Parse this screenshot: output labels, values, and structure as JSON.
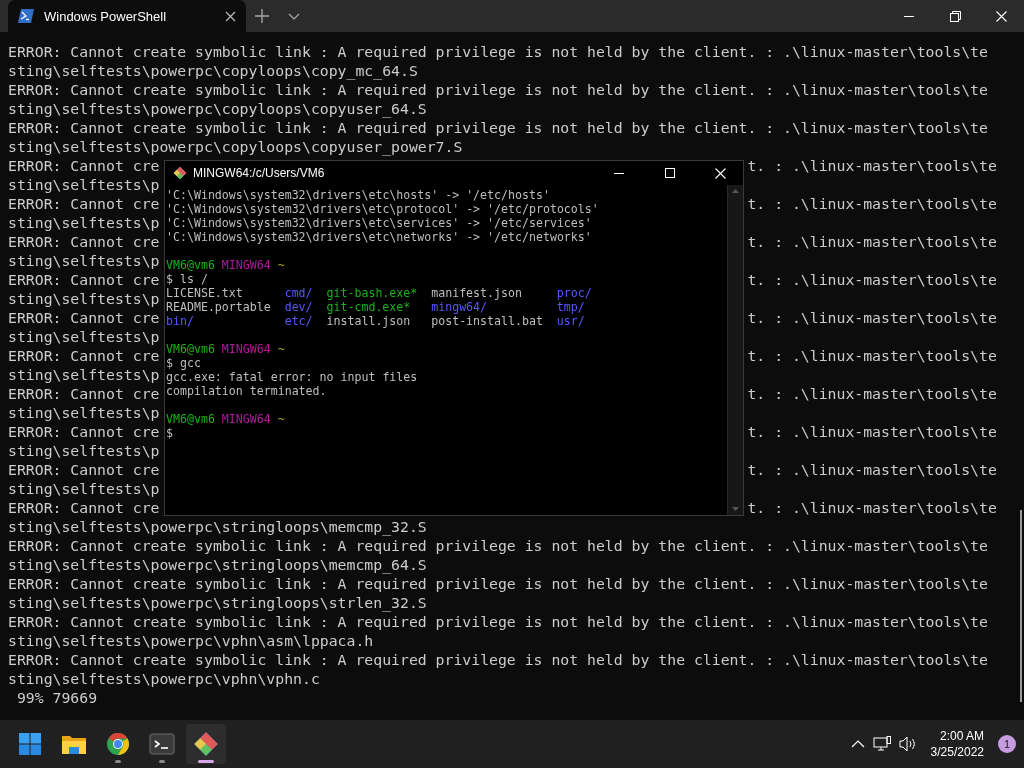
{
  "window": {
    "tab": {
      "title": "Windows PowerShell",
      "selected": true
    }
  },
  "console": {
    "lines": [
      {
        "kind": "full",
        "text": "ERROR: Cannot create symbolic link : A required privilege is not held by the client. : .\\linux-master\\tools\\te"
      },
      {
        "kind": "full",
        "text": "sting\\selftests\\powerpc\\copyloops\\copy_mc_64.S"
      },
      {
        "kind": "full",
        "text": "ERROR: Cannot create symbolic link : A required privilege is not held by the client. : .\\linux-master\\tools\\te"
      },
      {
        "kind": "full",
        "text": "sting\\selftests\\powerpc\\copyloops\\copyuser_64.S"
      },
      {
        "kind": "full",
        "text": "ERROR: Cannot create symbolic link : A required privilege is not held by the client. : .\\linux-master\\tools\\te"
      },
      {
        "kind": "full",
        "text": "sting\\selftests\\powerpc\\copyloops\\copyuser_power7.S"
      },
      {
        "kind": "split",
        "left": "ERROR: Cannot cre",
        "right": "t. : .\\linux-master\\tools\\te"
      },
      {
        "kind": "split",
        "left": "sting\\selftests\\p"
      },
      {
        "kind": "split",
        "left": "ERROR: Cannot cre",
        "right": "t. : .\\linux-master\\tools\\te"
      },
      {
        "kind": "split",
        "left": "sting\\selftests\\p"
      },
      {
        "kind": "split",
        "left": "ERROR: Cannot cre",
        "right": "t. : .\\linux-master\\tools\\te"
      },
      {
        "kind": "split",
        "left": "sting\\selftests\\p"
      },
      {
        "kind": "split",
        "left": "ERROR: Cannot cre",
        "right": "t. : .\\linux-master\\tools\\te"
      },
      {
        "kind": "split",
        "left": "sting\\selftests\\p"
      },
      {
        "kind": "split",
        "left": "ERROR: Cannot cre",
        "right": "t. : .\\linux-master\\tools\\te"
      },
      {
        "kind": "split",
        "left": "sting\\selftests\\p"
      },
      {
        "kind": "split",
        "left": "ERROR: Cannot cre",
        "right": "t. : .\\linux-master\\tools\\te"
      },
      {
        "kind": "split",
        "left": "sting\\selftests\\p"
      },
      {
        "kind": "split",
        "left": "ERROR: Cannot cre",
        "right": "t. : .\\linux-master\\tools\\te"
      },
      {
        "kind": "split",
        "left": "sting\\selftests\\p"
      },
      {
        "kind": "split",
        "left": "ERROR: Cannot cre",
        "right": "t. : .\\linux-master\\tools\\te"
      },
      {
        "kind": "split",
        "left": "sting\\selftests\\p"
      },
      {
        "kind": "split",
        "left": "ERROR: Cannot cre",
        "right": "t. : .\\linux-master\\tools\\te"
      },
      {
        "kind": "split",
        "left": "sting\\selftests\\p"
      },
      {
        "kind": "split",
        "left": "ERROR: Cannot cre",
        "right": "t. : .\\linux-master\\tools\\te"
      },
      {
        "kind": "full",
        "text": "sting\\selftests\\powerpc\\stringloops\\memcmp_32.S"
      },
      {
        "kind": "full",
        "text": "ERROR: Cannot create symbolic link : A required privilege is not held by the client. : .\\linux-master\\tools\\te"
      },
      {
        "kind": "full",
        "text": "sting\\selftests\\powerpc\\stringloops\\memcmp_64.S"
      },
      {
        "kind": "full",
        "text": "ERROR: Cannot create symbolic link : A required privilege is not held by the client. : .\\linux-master\\tools\\te"
      },
      {
        "kind": "full",
        "text": "sting\\selftests\\powerpc\\stringloops\\strlen_32.S"
      },
      {
        "kind": "full",
        "text": "ERROR: Cannot create symbolic link : A required privilege is not held by the client. : .\\linux-master\\tools\\te"
      },
      {
        "kind": "full",
        "text": "sting\\selftests\\powerpc\\vphn\\asm\\lppaca.h"
      },
      {
        "kind": "full",
        "text": "ERROR: Cannot create symbolic link : A required privilege is not held by the client. : .\\linux-master\\tools\\te"
      },
      {
        "kind": "full",
        "text": "sting\\selftests\\powerpc\\vphn\\vphn.c"
      },
      {
        "kind": "full",
        "text": " 99% 79669"
      }
    ]
  },
  "mintty": {
    "title": "MINGW64:/c/Users/VM6",
    "content": [
      {
        "kind": "line",
        "segments": [
          {
            "kind": "plain",
            "text": "'C:\\Windows\\system32\\drivers\\etc\\hosts' -> '/etc/hosts'"
          }
        ]
      },
      {
        "kind": "line",
        "segments": [
          {
            "kind": "plain",
            "text": "'C:\\Windows\\system32\\drivers\\etc\\protocol' -> '/etc/protocols'"
          }
        ]
      },
      {
        "kind": "line",
        "segments": [
          {
            "kind": "plain",
            "text": "'C:\\Windows\\system32\\drivers\\etc\\services' -> '/etc/services'"
          }
        ]
      },
      {
        "kind": "line",
        "segments": [
          {
            "kind": "plain",
            "text": "'C:\\Windows\\system32\\drivers\\etc\\networks' -> '/etc/networks'"
          }
        ]
      },
      {
        "kind": "blank"
      },
      {
        "kind": "line",
        "segments": [
          {
            "kind": "user",
            "text": "VM6@vm6"
          },
          {
            "kind": "host",
            "text": "MINGW64"
          },
          {
            "kind": "path",
            "text": "~"
          }
        ]
      },
      {
        "kind": "line",
        "segments": [
          {
            "kind": "plain",
            "text": "$ ls /"
          }
        ]
      },
      {
        "kind": "grid",
        "entries": [
          {
            "kind": "file",
            "text": "LICENSE.txt"
          },
          {
            "kind": "dir",
            "text": "cmd/"
          },
          {
            "kind": "exec",
            "text": "git-bash.exe*"
          },
          {
            "kind": "file",
            "text": "manifest.json"
          },
          {
            "kind": "dir",
            "text": "proc/"
          },
          {
            "kind": "file",
            "text": "README.portable"
          },
          {
            "kind": "dir",
            "text": "dev/"
          },
          {
            "kind": "exec",
            "text": "git-cmd.exe*"
          },
          {
            "kind": "dir",
            "text": "mingw64/"
          },
          {
            "kind": "dir",
            "text": "tmp/"
          },
          {
            "kind": "dir",
            "text": "bin/"
          },
          {
            "kind": "dir",
            "text": "etc/"
          },
          {
            "kind": "file",
            "text": "install.json"
          },
          {
            "kind": "file",
            "text": "post-install.bat"
          },
          {
            "kind": "dir",
            "text": "usr/"
          }
        ]
      },
      {
        "kind": "blank"
      },
      {
        "kind": "line",
        "segments": [
          {
            "kind": "user",
            "text": "VM6@vm6"
          },
          {
            "kind": "host",
            "text": "MINGW64"
          },
          {
            "kind": "path",
            "text": "~"
          }
        ]
      },
      {
        "kind": "line",
        "segments": [
          {
            "kind": "plain",
            "text": "$ gcc"
          }
        ]
      },
      {
        "kind": "line",
        "segments": [
          {
            "kind": "plain",
            "text": "gcc.exe: fatal error: no input files"
          }
        ]
      },
      {
        "kind": "line",
        "segments": [
          {
            "kind": "plain",
            "text": "compilation terminated."
          }
        ]
      },
      {
        "kind": "blank"
      },
      {
        "kind": "line",
        "segments": [
          {
            "kind": "user",
            "text": "VM6@vm6"
          },
          {
            "kind": "host",
            "text": "MINGW64"
          },
          {
            "kind": "path",
            "text": "~"
          }
        ]
      },
      {
        "kind": "line",
        "segments": [
          {
            "kind": "plain",
            "text": "$"
          }
        ]
      }
    ]
  },
  "taskbar": {
    "apps": [
      {
        "kind": "start",
        "running": false,
        "selected": false
      },
      {
        "kind": "folder",
        "running": false,
        "selected": false
      },
      {
        "kind": "browser",
        "running": true,
        "selected": false
      },
      {
        "kind": "terminal",
        "running": true,
        "selected": false
      },
      {
        "kind": "git",
        "running": true,
        "selected": true
      }
    ],
    "time": "2:00 AM",
    "date": "3/25/2022",
    "notifications": "1"
  }
}
